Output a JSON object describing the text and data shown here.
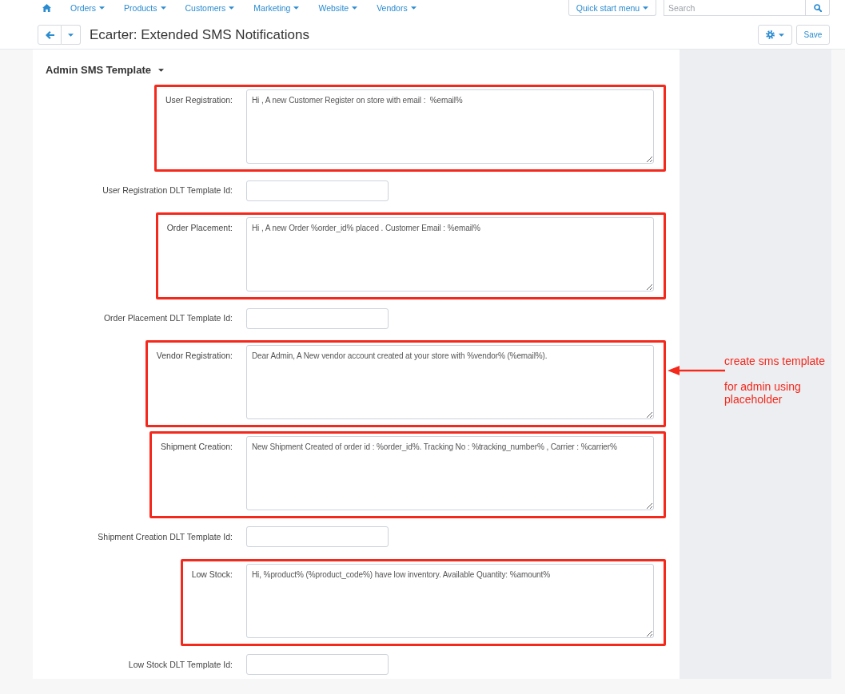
{
  "navbar": {
    "items": [
      {
        "label": "Orders"
      },
      {
        "label": "Products"
      },
      {
        "label": "Customers"
      },
      {
        "label": "Marketing"
      },
      {
        "label": "Website"
      },
      {
        "label": "Vendors"
      }
    ],
    "quick_start": {
      "label": "Quick start menu"
    },
    "search": {
      "placeholder": "Search"
    }
  },
  "page_header": {
    "title": "Ecarter: Extended SMS Notifications",
    "save_label": "Save"
  },
  "section": {
    "title": "Admin SMS Template"
  },
  "fields": [
    {
      "kind": "textarea",
      "label": "User Registration:",
      "value": "Hi , A new Customer Register on store with email :  %email%",
      "highlighted": true
    },
    {
      "kind": "input",
      "label": "User Registration DLT Template Id:",
      "highlighted": false
    },
    {
      "kind": "textarea",
      "label": "Order Placement:",
      "value": "Hi , A new Order %order_id% placed . Customer Email : %email%",
      "highlighted": true
    },
    {
      "kind": "input",
      "label": "Order Placement DLT Template Id:",
      "highlighted": false
    },
    {
      "kind": "textarea",
      "label": "Vendor Registration:",
      "value": "Dear Admin, A New vendor account created at your store with %vendor% (%email%).",
      "highlighted": true,
      "callout": [
        "create sms template",
        "for admin using placeholder"
      ]
    },
    {
      "kind": "textarea",
      "label": "Shipment Creation:",
      "value": "New Shipment Created of order id : %order_id%. Tracking No : %tracking_number% , Carrier : %carrier%",
      "highlighted": true
    },
    {
      "kind": "input",
      "label": "Shipment Creation DLT Template Id:",
      "highlighted": false
    },
    {
      "kind": "textarea",
      "label": "Low Stock:",
      "value": "Hi, %product% (%product_code%) have low inventory. Available Quantity: %amount%",
      "highlighted": true
    },
    {
      "kind": "input",
      "label": "Low Stock DLT Template Id:",
      "highlighted": false
    }
  ]
}
